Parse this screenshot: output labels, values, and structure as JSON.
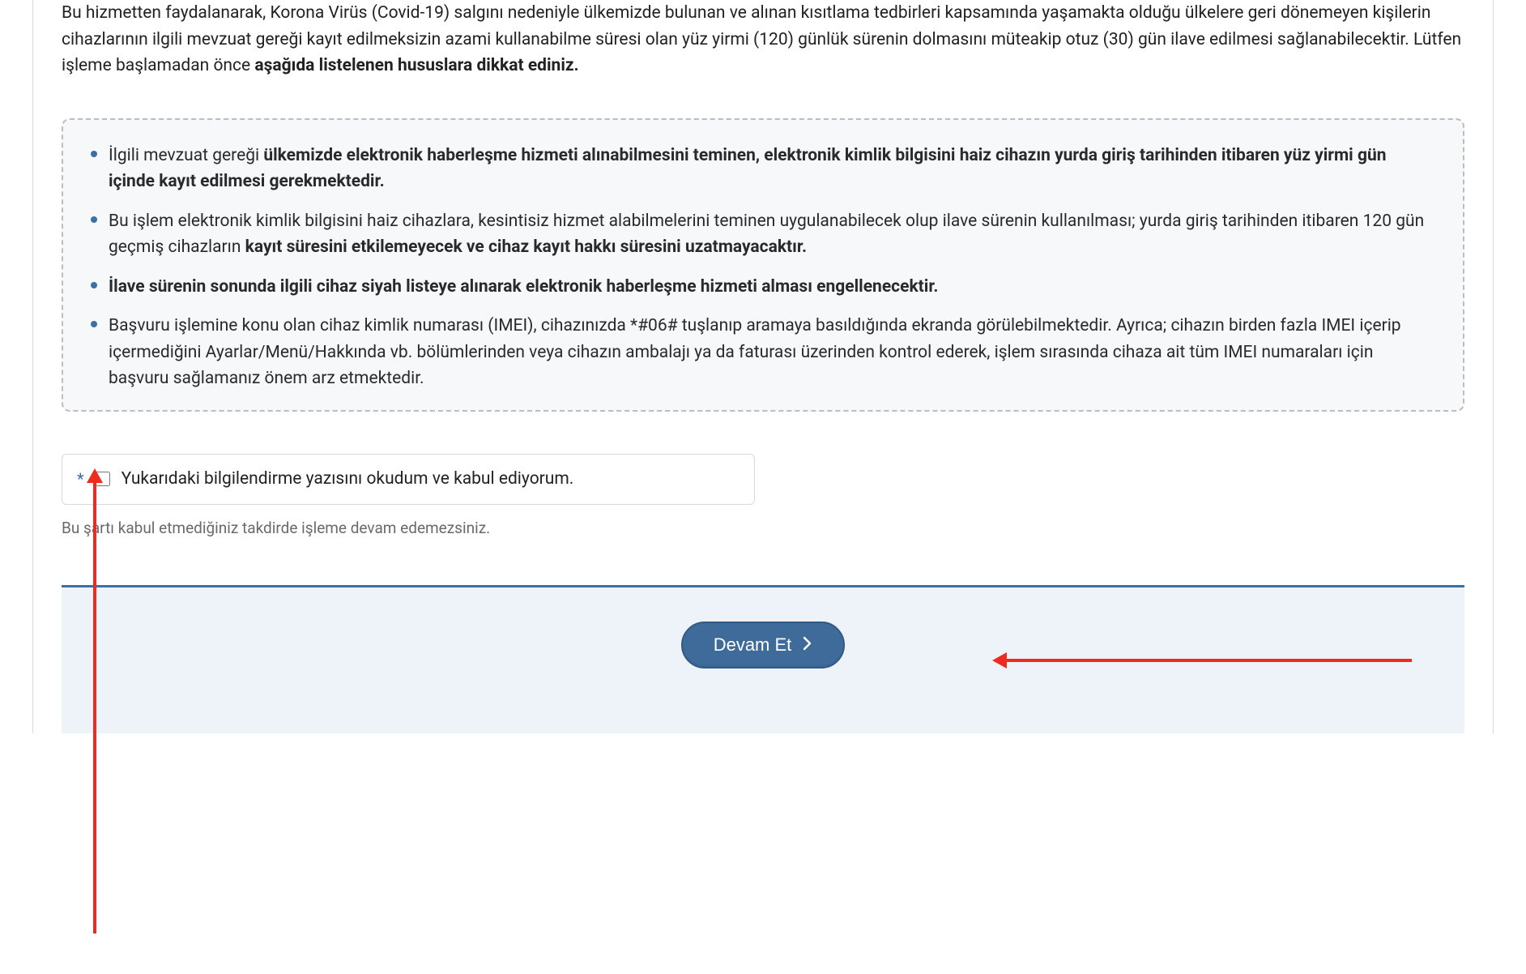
{
  "intro": {
    "line1": "Bu hizmetten faydalanarak, Korona Virüs (Covid-19) salgını nedeniyle ülkemizde bulunan ve alınan kısıtlama tedbirleri kapsamında yaşamakta olduğu ülkelere geri dönemeyen kişilerin cihazlarının ilgili mevzuat gereği kayıt edilmeksizin azami kullanabilme süresi olan yüz yirmi (120) günlük sürenin dolmasını müteakip otuz (30) gün ilave edilmesi sağlanabilecektir. Lütfen işleme başlamadan önce ",
    "bold": "aşağıda listelenen hususlara dikkat ediniz."
  },
  "notice": {
    "item1_pre": "İlgili mevzuat gereği ",
    "item1_bold": "ülkemizde elektronik haberleşme hizmeti alınabilmesini teminen, elektronik kimlik bilgisini haiz cihazın yurda giriş tarihinden itibaren yüz yirmi gün içinde kayıt edilmesi gerekmektedir.",
    "item2_pre": "Bu işlem elektronik kimlik bilgisini haiz cihazlara, kesintisiz hizmet alabilmelerini teminen uygulanabilecek olup ilave sürenin kullanılması; yurda giriş tarihinden itibaren 120 gün geçmiş cihazların ",
    "item2_bold": "kayıt süresini etkilemeyecek ve cihaz kayıt hakkı süresini uzatmayacaktır.",
    "item3_bold": "İlave sürenin sonunda ilgili cihaz siyah listeye alınarak elektronik haberleşme hizmeti alması engellenecektir.",
    "item4": "Başvuru işlemine konu olan cihaz kimlik numarası (IMEI), cihazınızda *#06# tuşlanıp aramaya basıldığında ekranda görülebilmektedir. Ayrıca; cihazın birden fazla IMEI içerip içermediğini Ayarlar/Menü/Hakkında vb. bölümlerinden veya cihazın ambalajı ya da faturası üzerinden kontrol ederek, işlem sırasında cihaza ait tüm IMEI numaraları için başvuru sağlamanız önem arz etmektedir."
  },
  "consent": {
    "required_mark": "*",
    "label": "Yukarıdaki bilgilendirme yazısını okudum ve kabul ediyorum.",
    "hint": "Bu şartı kabul etmediğiniz takdirde işleme devam edemezsiniz."
  },
  "actions": {
    "continue_label": "Devam Et"
  }
}
